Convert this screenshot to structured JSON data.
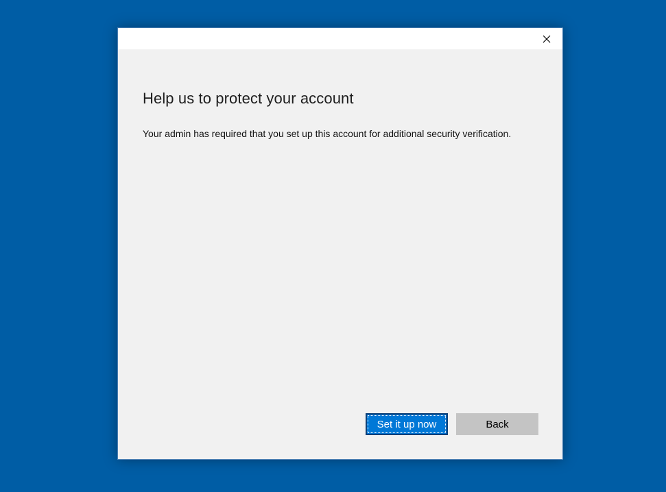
{
  "dialog": {
    "close_icon": "close-icon",
    "heading": "Help us to protect your account",
    "message": "Your admin has required that you set up this account for additional security verification.",
    "primary_button": "Set it up now",
    "secondary_button": "Back"
  },
  "colors": {
    "desktop_background": "#005da5",
    "dialog_background": "#f1f1f1",
    "titlebar_background": "#ffffff",
    "primary_button": "#0078d7",
    "secondary_button": "#c4c4c4"
  }
}
